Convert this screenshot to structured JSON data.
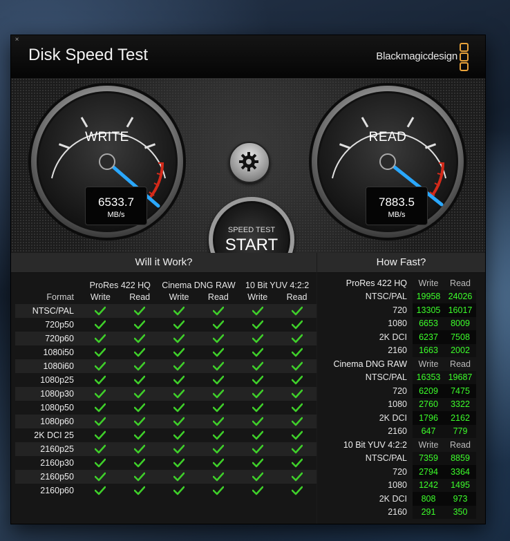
{
  "app": {
    "title": "Disk Speed Test",
    "brand": "Blackmagicdesign",
    "close_glyph": "×",
    "accent": "#e8a23a"
  },
  "gauges": {
    "write": {
      "label": "WRITE",
      "value": "6533.7",
      "unit": "MB/s"
    },
    "read": {
      "label": "READ",
      "value": "7883.5",
      "unit": "MB/s"
    }
  },
  "start_button": {
    "small": "SPEED TEST",
    "big": "START"
  },
  "settings_icon": "gear-icon",
  "will_it_work": {
    "title": "Will it Work?",
    "format_label": "Format",
    "codecs": [
      "ProRes 422 HQ",
      "Cinema DNG RAW",
      "10 Bit YUV 4:2:2"
    ],
    "subheaders": [
      "Write",
      "Read",
      "Write",
      "Read",
      "Write",
      "Read"
    ],
    "rows": [
      "NTSC/PAL",
      "720p50",
      "720p60",
      "1080i50",
      "1080i60",
      "1080p25",
      "1080p30",
      "1080p50",
      "1080p60",
      "2K DCI 25",
      "2160p25",
      "2160p30",
      "2160p50",
      "2160p60"
    ],
    "status": "check",
    "check_color": "#3fcf2a"
  },
  "how_fast": {
    "title": "How Fast?",
    "col_write": "Write",
    "col_read": "Read",
    "number_color": "#3cff2a",
    "sections": [
      {
        "name": "ProRes 422 HQ",
        "rows": [
          {
            "label": "NTSC/PAL",
            "write": "19958",
            "read": "24026"
          },
          {
            "label": "720",
            "write": "13305",
            "read": "16017"
          },
          {
            "label": "1080",
            "write": "6653",
            "read": "8009"
          },
          {
            "label": "2K DCI",
            "write": "6237",
            "read": "7508"
          },
          {
            "label": "2160",
            "write": "1663",
            "read": "2002"
          }
        ]
      },
      {
        "name": "Cinema DNG RAW",
        "rows": [
          {
            "label": "NTSC/PAL",
            "write": "16353",
            "read": "19687"
          },
          {
            "label": "720",
            "write": "6209",
            "read": "7475"
          },
          {
            "label": "1080",
            "write": "2760",
            "read": "3322"
          },
          {
            "label": "2K DCI",
            "write": "1796",
            "read": "2162"
          },
          {
            "label": "2160",
            "write": "647",
            "read": "779"
          }
        ]
      },
      {
        "name": "10 Bit YUV 4:2:2",
        "rows": [
          {
            "label": "NTSC/PAL",
            "write": "7359",
            "read": "8859"
          },
          {
            "label": "720",
            "write": "2794",
            "read": "3364"
          },
          {
            "label": "1080",
            "write": "1242",
            "read": "1495"
          },
          {
            "label": "2K DCI",
            "write": "808",
            "read": "973"
          },
          {
            "label": "2160",
            "write": "291",
            "read": "350"
          }
        ]
      }
    ]
  }
}
